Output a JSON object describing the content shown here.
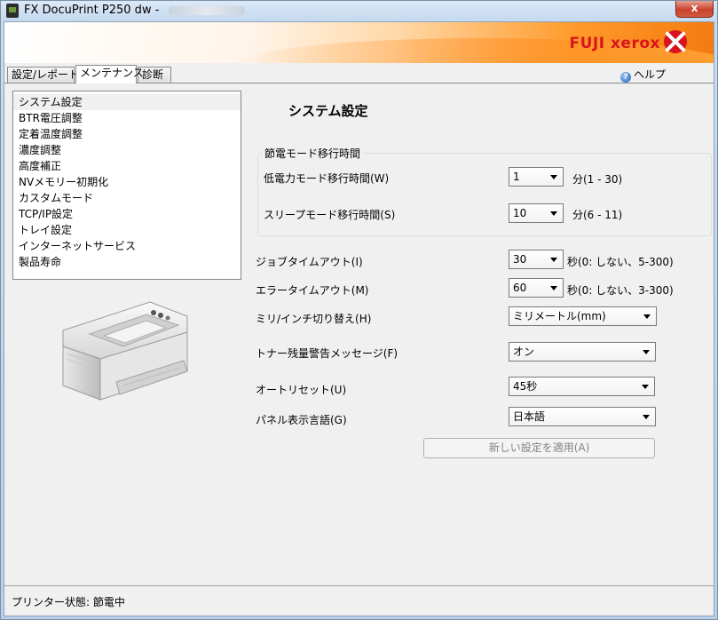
{
  "window": {
    "title": "FX DocuPrint P250 dw - ",
    "close_label": "x"
  },
  "brand": {
    "logo_text": "FUJI xerox"
  },
  "tabs": [
    {
      "label": "設定/レポート"
    },
    {
      "label": "メンテナンス"
    },
    {
      "label": "診断"
    }
  ],
  "help_label": "ヘルプ",
  "menu": {
    "items": [
      {
        "label": "システム設定"
      },
      {
        "label": "BTR電圧調整"
      },
      {
        "label": "定着温度調整"
      },
      {
        "label": "濃度調整"
      },
      {
        "label": "高度補正"
      },
      {
        "label": "NVメモリー初期化"
      },
      {
        "label": "カスタムモード"
      },
      {
        "label": "TCP/IP設定"
      },
      {
        "label": "トレイ設定"
      },
      {
        "label": "インターネットサービス"
      },
      {
        "label": "製品寿命"
      }
    ]
  },
  "section": {
    "title": "システム設定"
  },
  "power_saving": {
    "legend": "節電モード移行時間",
    "low_power": {
      "label": "低電力モード移行時間(W)",
      "value": "1",
      "unit": "分(1 - 30)"
    },
    "sleep": {
      "label": "スリープモード移行時間(S)",
      "value": "10",
      "unit": "分(6 - 11)"
    }
  },
  "settings": {
    "job_timeout": {
      "label": "ジョブタイムアウト(I)",
      "value": "30",
      "unit": "秒(0: しない、5-300)"
    },
    "error_timeout": {
      "label": "エラータイムアウト(M)",
      "value": "60",
      "unit": "秒(0: しない、3-300)"
    },
    "mm_inch": {
      "label": "ミリ/インチ切り替え(H)",
      "value": "ミリメートル(mm)"
    },
    "toner_warning": {
      "label": "トナー残量警告メッセージ(F)",
      "value": "オン"
    },
    "auto_reset": {
      "label": "オートリセット(U)",
      "value": "45秒"
    },
    "panel_language": {
      "label": "パネル表示言語(G)",
      "value": "日本語"
    }
  },
  "apply_button": "新しい設定を適用(A)",
  "status": {
    "text": "プリンター状態: 節電中"
  }
}
